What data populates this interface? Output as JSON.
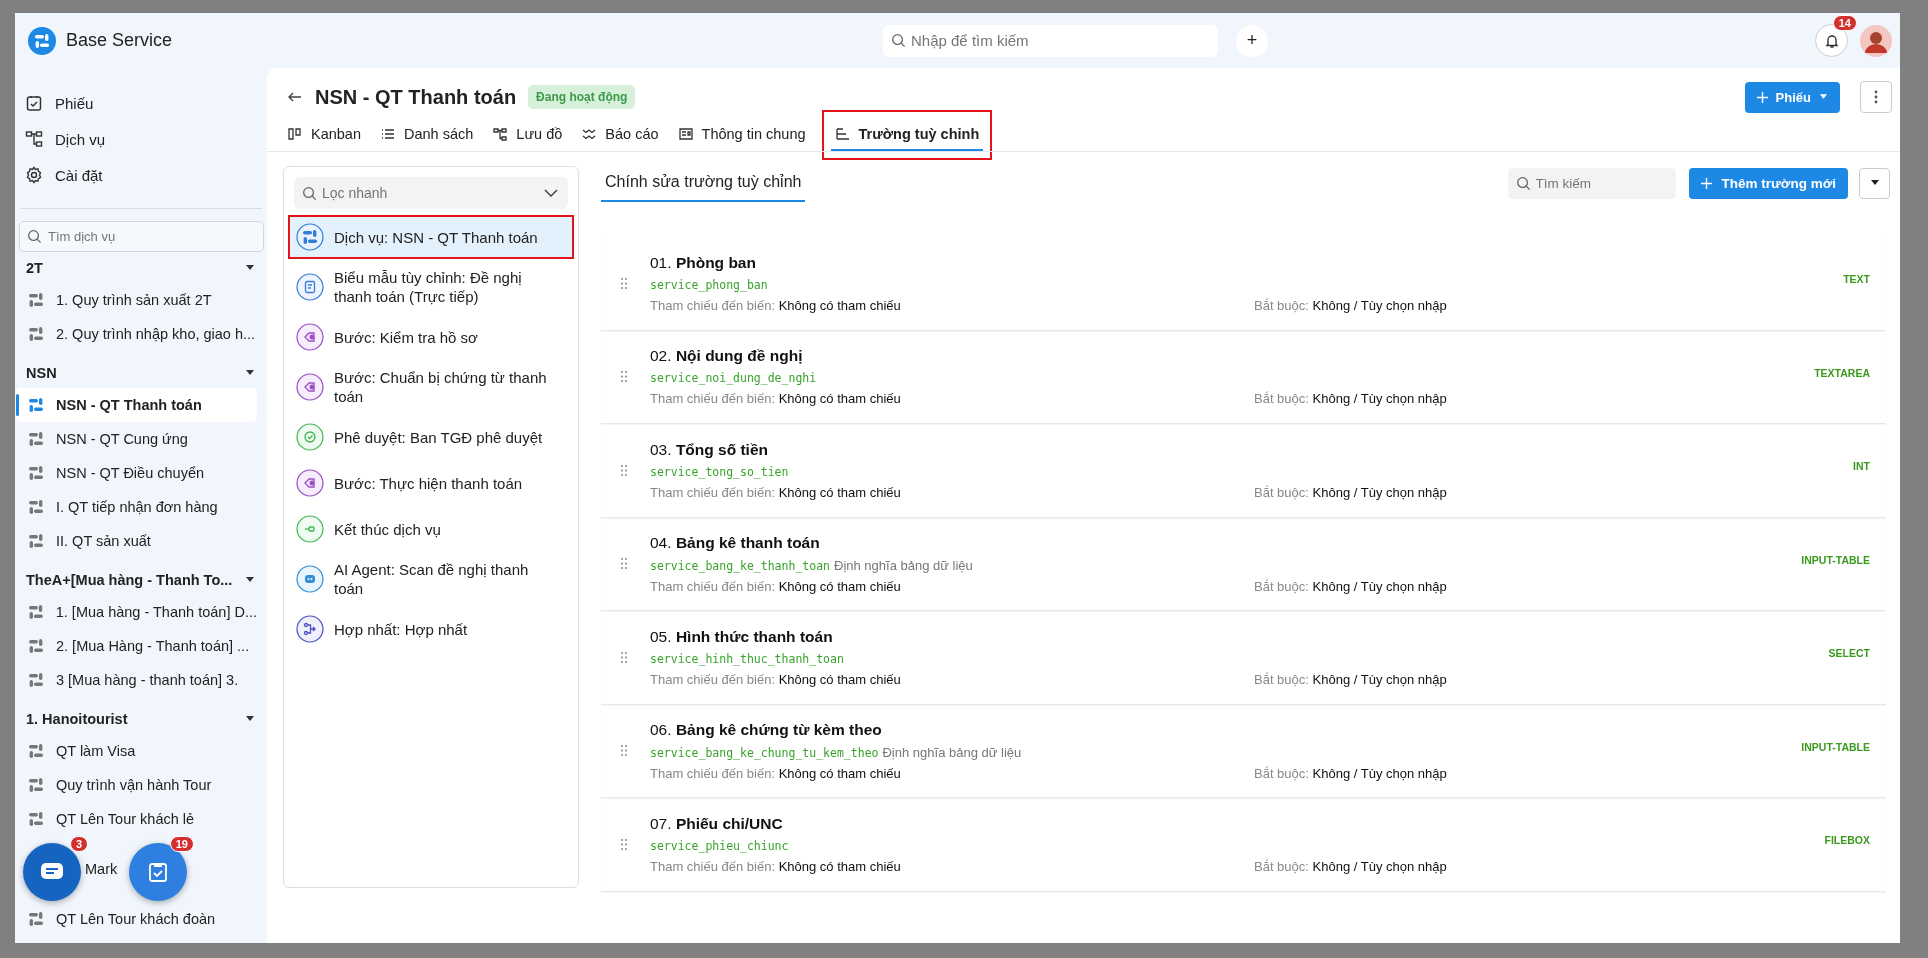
{
  "app": {
    "name": "Base Service"
  },
  "topbar": {
    "search_placeholder": "Nhập để tìm kiếm",
    "plus": "+",
    "notifications": "14"
  },
  "nav": [
    {
      "label": "Phiếu",
      "kind": "ticket"
    },
    {
      "label": "Dịch vụ",
      "kind": "flow"
    },
    {
      "label": "Cài đặt",
      "kind": "gear"
    }
  ],
  "service_search": {
    "placeholder": "Tìm dịch vụ"
  },
  "groups": [
    {
      "name": "2T",
      "expanded": true,
      "items": [
        {
          "label": "1. Quy trình sản xuất 2T",
          "selected": false,
          "kind": "service"
        },
        {
          "label": "2. Quy trình nhập kho, giao h...",
          "selected": false,
          "kind": "service"
        }
      ]
    },
    {
      "name": "NSN",
      "expanded": true,
      "items": [
        {
          "label": "NSN - QT Thanh toán",
          "selected": true,
          "kind": "service"
        },
        {
          "label": "NSN - QT Cung ứng",
          "selected": false,
          "kind": "service"
        },
        {
          "label": "NSN - QT Điều chuyển",
          "selected": false,
          "kind": "service"
        },
        {
          "label": "I. QT tiếp nhận đơn hàng",
          "selected": false,
          "kind": "service"
        },
        {
          "label": "II. QT sản xuất",
          "selected": false,
          "kind": "service"
        }
      ]
    },
    {
      "name": "TheA+[Mua hàng - Thanh To...",
      "expanded": true,
      "items": [
        {
          "label": "1. [Mua hàng - Thanh toán] D...",
          "selected": false,
          "kind": "service"
        },
        {
          "label": "2. [Mua Hàng - Thanh toán] ...",
          "selected": false,
          "kind": "service"
        },
        {
          "label": "3 [Mua hàng - thanh toán] 3.",
          "selected": false,
          "kind": "service"
        }
      ]
    },
    {
      "name": "1. Hanoitourist",
      "expanded": true,
      "items": [
        {
          "label": "QT làm Visa",
          "selected": false,
          "kind": "service"
        },
        {
          "label": "Quy trình vận hành Tour",
          "selected": false,
          "kind": "service"
        },
        {
          "label": "QT Lên Tour khách lẻ",
          "selected": false,
          "kind": "service"
        },
        {
          "label": "Mark",
          "selected": false,
          "kind": "covered"
        },
        {
          "label": "QT Lên Tour khách đoàn",
          "selected": false,
          "kind": "service"
        }
      ]
    }
  ],
  "floating": [
    {
      "kind": "chat",
      "badge": "3"
    },
    {
      "kind": "task",
      "badge": "19"
    }
  ],
  "page": {
    "title": "NSN - QT Thanh toán",
    "status": "Đang hoạt động",
    "new_button": "Phiếu"
  },
  "tabs": [
    {
      "label": "Kanban",
      "kind": "kanban",
      "selected": false,
      "highlighted": false
    },
    {
      "label": "Danh sách",
      "kind": "list",
      "selected": false,
      "highlighted": false
    },
    {
      "label": "Lưu đồ",
      "kind": "flow",
      "selected": false,
      "highlighted": false
    },
    {
      "label": "Báo cáo",
      "kind": "report",
      "selected": false,
      "highlighted": false
    },
    {
      "label": "Thông tin chung",
      "kind": "info",
      "selected": false,
      "highlighted": false
    },
    {
      "label": "Trường tuỳ chỉnh",
      "kind": "fields",
      "selected": true,
      "highlighted": true
    }
  ],
  "filter": {
    "placeholder": "Lọc nhanh"
  },
  "nodes": [
    {
      "label": "Dịch vụ: NSN - QT Thanh toán",
      "kind": "service",
      "selected": true,
      "highlighted": true
    },
    {
      "label": "Biểu mẫu tùy chỉnh: Đề nghị thanh toán (Trực tiếp)",
      "kind": "form",
      "selected": false,
      "highlighted": false
    },
    {
      "label": "Bước: Kiểm tra hồ sơ",
      "kind": "step",
      "selected": false,
      "highlighted": false
    },
    {
      "label": "Bước: Chuẩn bị chứng từ thanh toán",
      "kind": "step",
      "selected": false,
      "highlighted": false
    },
    {
      "label": "Phê duyệt: Ban TGĐ phê duyệt",
      "kind": "approval",
      "selected": false,
      "highlighted": false
    },
    {
      "label": "Bước: Thực hiện thanh toán",
      "kind": "step",
      "selected": false,
      "highlighted": false
    },
    {
      "label": "Kết thúc dịch vụ",
      "kind": "end",
      "selected": false,
      "highlighted": false
    },
    {
      "label": "AI Agent: Scan đề nghị thanh toán",
      "kind": "ai",
      "selected": false,
      "highlighted": false
    },
    {
      "label": "Hợp nhất: Hợp nhất",
      "kind": "merge",
      "selected": false,
      "highlighted": false
    }
  ],
  "editor": {
    "subtab": "Chính sửa trường tuỳ chỉnh",
    "search_placeholder": "Tìm kiếm",
    "add_button": "Thêm trường mới"
  },
  "fields": [
    {
      "number": "01.",
      "title": "Phòng ban",
      "code": "service_phong_ban",
      "ref_label": "Tham chiếu đến biến:",
      "ref_value": "Không có tham chiếu",
      "req_label": "Bắt buộc:",
      "req_value": "Không / Tùy chọn nhập",
      "type": "TEXT"
    },
    {
      "number": "02.",
      "title": "Nội dung đề nghị",
      "code": "service_noi_dung_de_nghi",
      "ref_label": "Tham chiếu đến biến:",
      "ref_value": "Không có tham chiếu",
      "req_label": "Bắt buộc:",
      "req_value": "Không / Tùy chọn nhập",
      "type": "TEXTAREA"
    },
    {
      "number": "03.",
      "title": "Tổng số tiền",
      "code": "service_tong_so_tien",
      "ref_label": "Tham chiếu đến biến:",
      "ref_value": "Không có tham chiếu",
      "req_label": "Bắt buộc:",
      "req_value": "Không / Tùy chọn nhập",
      "type": "INT"
    },
    {
      "number": "04.",
      "title": "Bảng kê thanh toán",
      "code": "service_bang_ke_thanh_toan",
      "definition": "Định nghĩa bảng dữ liệu",
      "ref_label": "Tham chiếu đến biến:",
      "ref_value": "Không có tham chiếu",
      "req_label": "Bắt buộc:",
      "req_value": "Không / Tùy chọn nhập",
      "type": "INPUT-TABLE"
    },
    {
      "number": "05.",
      "title": "Hình thức thanh toán",
      "code": "service_hinh_thuc_thanh_toan",
      "ref_label": "Tham chiếu đến biến:",
      "ref_value": "Không có tham chiếu",
      "req_label": "Bắt buộc:",
      "req_value": "Không / Tùy chọn nhập",
      "type": "SELECT"
    },
    {
      "number": "06.",
      "title": "Bảng kê chứng từ kèm theo",
      "code": "service_bang_ke_chung_tu_kem_theo",
      "definition": "Định nghĩa bảng dữ liệu",
      "ref_label": "Tham chiếu đến biến:",
      "ref_value": "Không có tham chiếu",
      "req_label": "Bắt buộc:",
      "req_value": "Không / Tùy chọn nhập",
      "type": "INPUT-TABLE"
    },
    {
      "number": "07.",
      "title": "Phiếu chi/UNC",
      "code": "service_phieu_chiunc",
      "ref_label": "Tham chiếu đến biến:",
      "ref_value": "Không có tham chiếu",
      "req_label": "Bắt buộc:",
      "req_value": "Không / Tùy chọn nhập",
      "type": "FILEBOX"
    }
  ]
}
